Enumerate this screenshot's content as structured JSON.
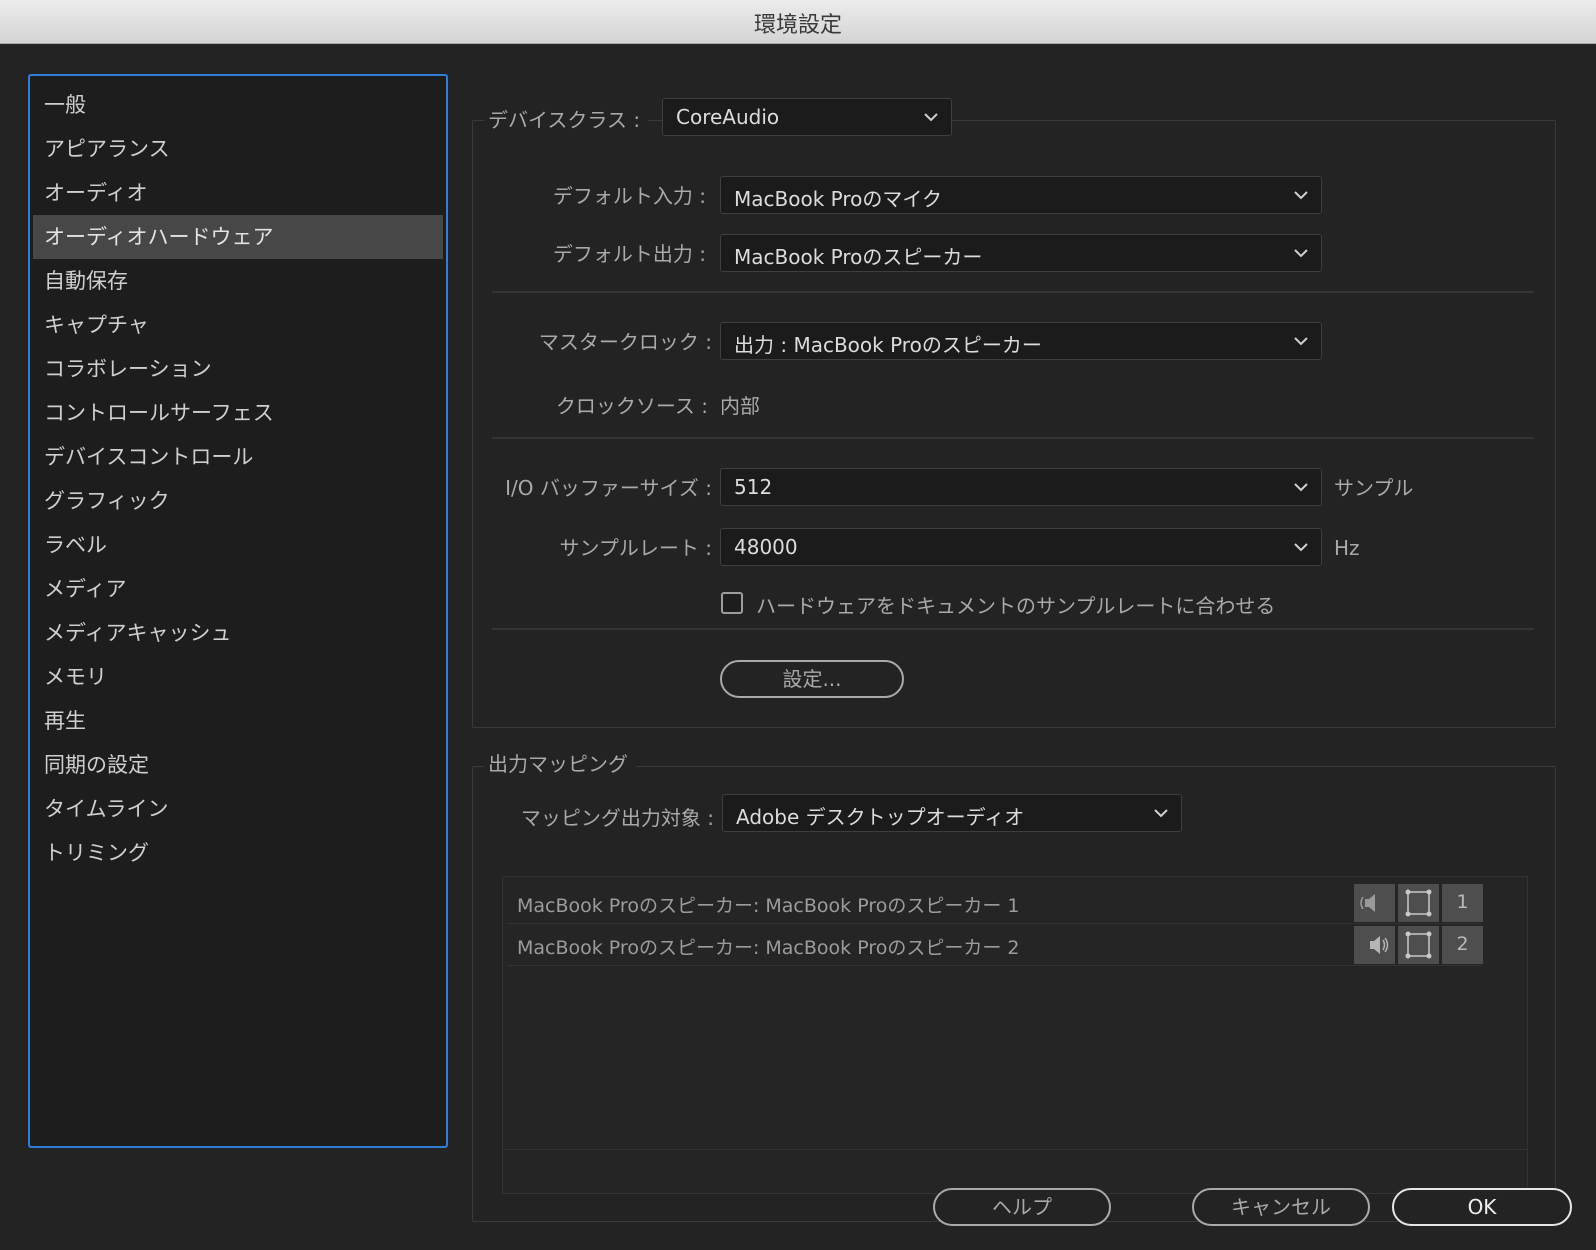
{
  "window": {
    "title": "環境設定"
  },
  "sidebar": {
    "items": [
      {
        "label": "一般"
      },
      {
        "label": "アピアランス"
      },
      {
        "label": "オーディオ"
      },
      {
        "label": "オーディオハードウェア",
        "selected": true
      },
      {
        "label": "自動保存"
      },
      {
        "label": "キャプチャ"
      },
      {
        "label": "コラボレーション"
      },
      {
        "label": "コントロールサーフェス"
      },
      {
        "label": "デバイスコントロール"
      },
      {
        "label": "グラフィック"
      },
      {
        "label": "ラベル"
      },
      {
        "label": "メディア"
      },
      {
        "label": "メディアキャッシュ"
      },
      {
        "label": "メモリ"
      },
      {
        "label": "再生"
      },
      {
        "label": "同期の設定"
      },
      {
        "label": "タイムライン"
      },
      {
        "label": "トリミング"
      }
    ]
  },
  "device": {
    "class_label": "デバイスクラス :",
    "class_value": "CoreAudio",
    "default_input_label": "デフォルト入力 :",
    "default_input_value": "MacBook Proのマイク",
    "default_output_label": "デフォルト出力 :",
    "default_output_value": "MacBook Proのスピーカー",
    "master_clock_label": "マスタークロック :",
    "master_clock_value": "出力 : MacBook Proのスピーカー",
    "clock_source_label": "クロックソース :",
    "clock_source_value": "内部",
    "buffer_label": "I/O バッファーサイズ :",
    "buffer_value": "512",
    "buffer_unit": "サンプル",
    "rate_label": "サンプルレート :",
    "rate_value": "48000",
    "rate_unit": "Hz",
    "match_checkbox_label": "ハードウェアをドキュメントのサンプルレートに合わせる",
    "match_checked": false,
    "settings_button": "設定..."
  },
  "output_mapping": {
    "legend": "出力マッピング",
    "target_label": "マッピング出力対象 :",
    "target_value": "Adobe デスクトップオーディオ",
    "rows": [
      {
        "name": "MacBook Proのスピーカー: MacBook Proのスピーカー 1",
        "channel": "1",
        "speaker_icon": "speaker-left-icon"
      },
      {
        "name": "MacBook Proのスピーカー: MacBook Proのスピーカー 2",
        "channel": "2",
        "speaker_icon": "speaker-right-icon"
      }
    ]
  },
  "footer": {
    "help": "ヘルプ",
    "cancel": "キャンセル",
    "ok": "OK"
  },
  "colors": {
    "background": "#232323",
    "selection": "#474747",
    "focus_border": "#2f7fd8"
  }
}
